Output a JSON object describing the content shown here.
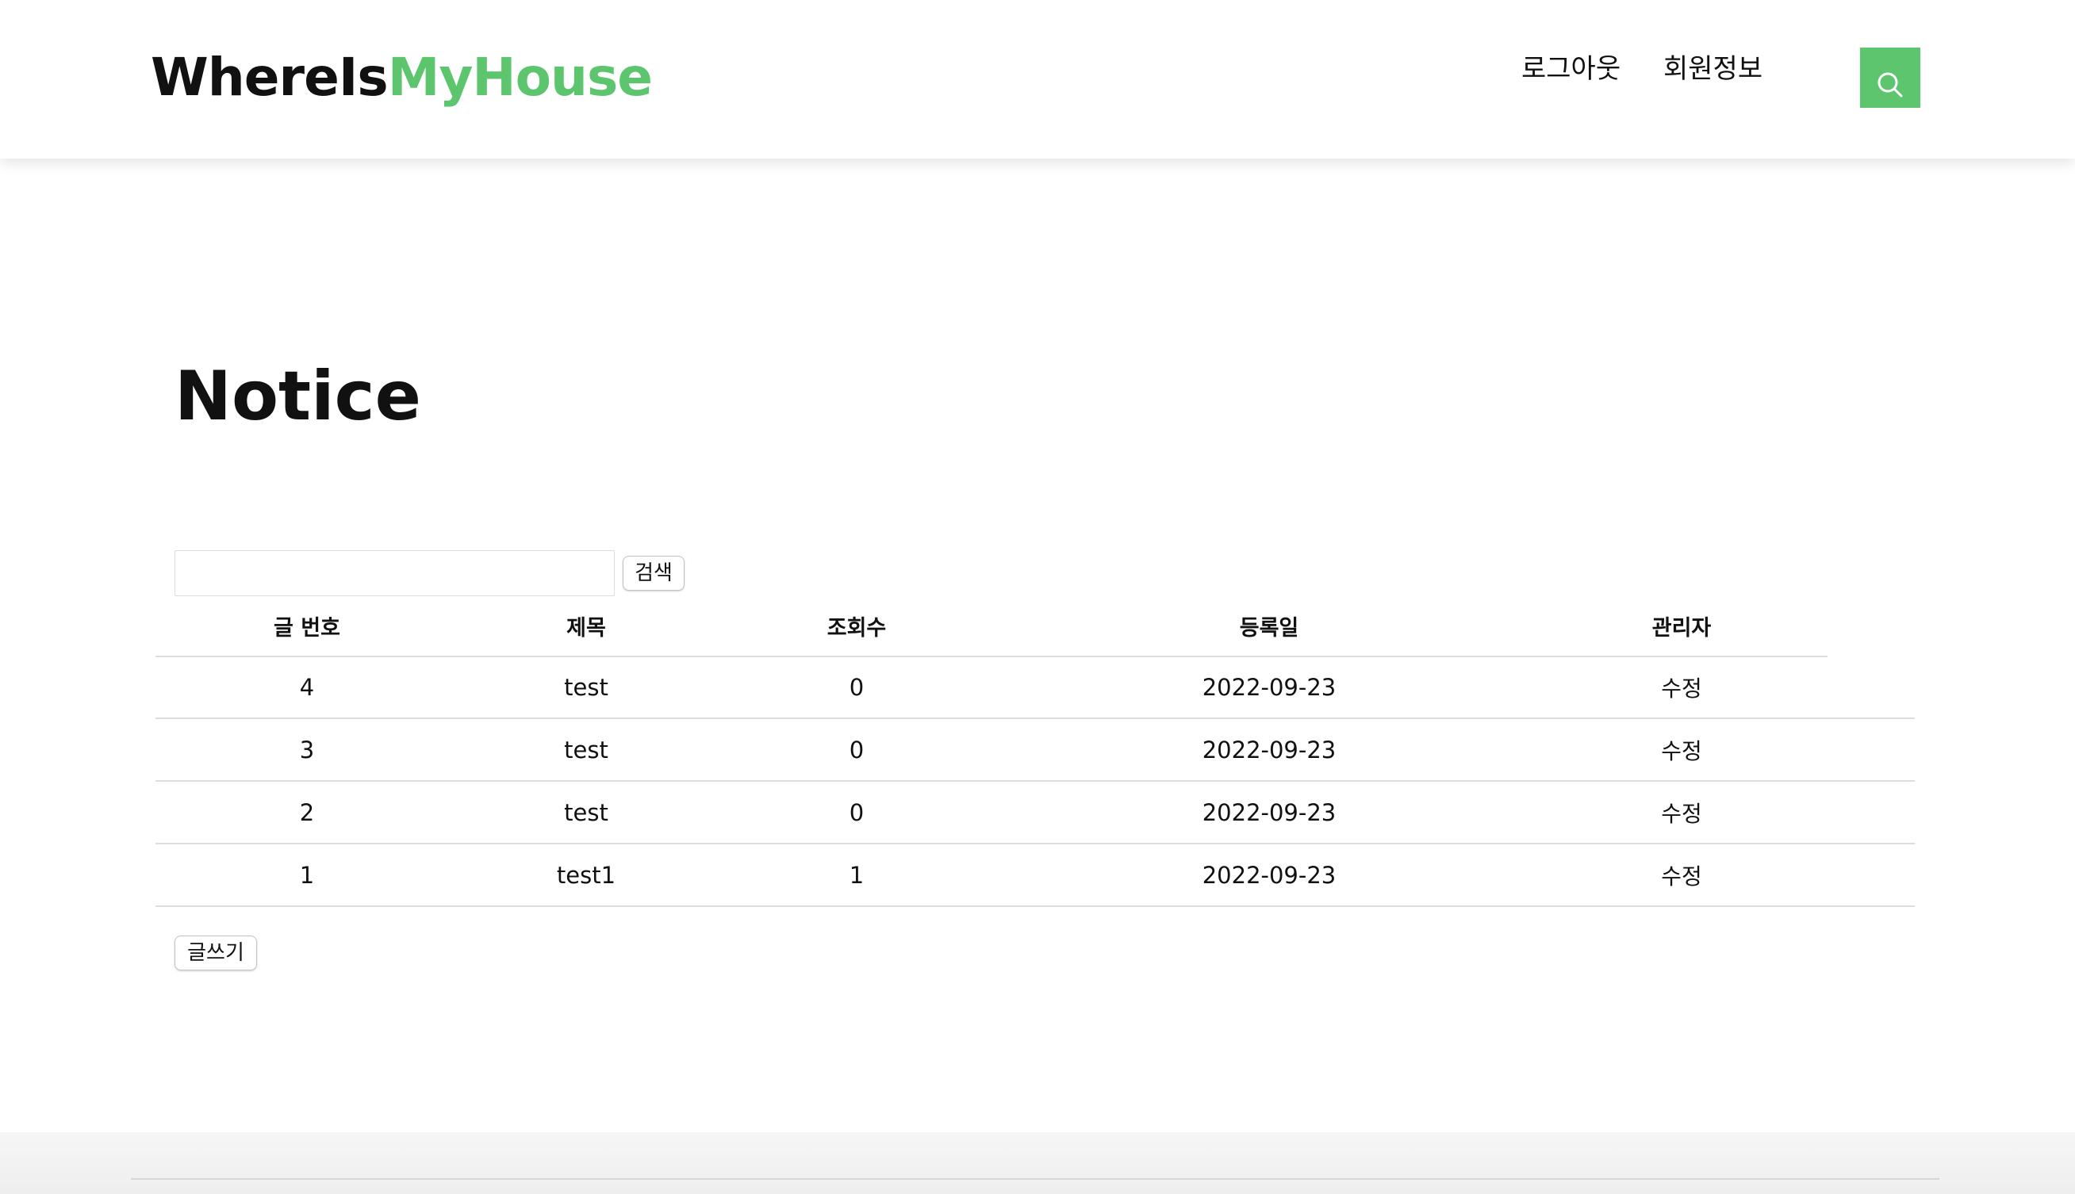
{
  "header": {
    "logo_part1": "WhereIs",
    "logo_part2": "MyHouse",
    "nav": {
      "logout_label": "로그아웃",
      "member_info_label": "회원정보"
    },
    "search_icon": "search-icon"
  },
  "page": {
    "title": "Notice"
  },
  "search": {
    "input_value": "",
    "button_label": "검색"
  },
  "table": {
    "columns": [
      "글 번호",
      "제목",
      "조회수",
      "등록일",
      "관리자"
    ],
    "rows": [
      {
        "no": "4",
        "title": "test",
        "views": "0",
        "date": "2022-09-23",
        "action": "수정"
      },
      {
        "no": "3",
        "title": "test",
        "views": "0",
        "date": "2022-09-23",
        "action": "수정"
      },
      {
        "no": "2",
        "title": "test",
        "views": "0",
        "date": "2022-09-23",
        "action": "수정"
      },
      {
        "no": "1",
        "title": "test1",
        "views": "1",
        "date": "2022-09-23",
        "action": "수정"
      }
    ]
  },
  "write_button_label": "글쓰기",
  "colors": {
    "accent": "#5cc56e",
    "text": "#111111",
    "divider": "#dddddd"
  }
}
